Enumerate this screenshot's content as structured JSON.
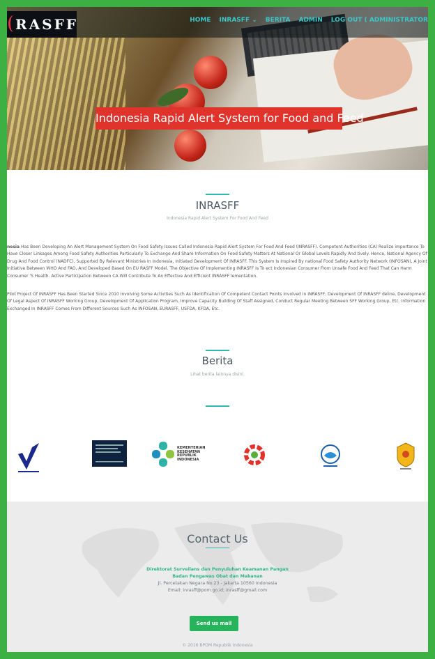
{
  "brand": {
    "logo_text": "RASFF"
  },
  "nav": {
    "items": [
      "HOME",
      "INRASFF",
      "BERITA",
      "ADMIN",
      "LOG OUT ( ADMINISTRATOR"
    ],
    "dropdown_indicator": "⌄"
  },
  "hero": {
    "banner": "Indonesia Rapid Alert System for Food and Feed"
  },
  "about": {
    "title": "INRASFF",
    "subtitle": "Indonesia Rapid Alert System For Food And Feed",
    "paragraph1_lead": "nesia",
    "paragraph1": "Has Been Developing An Alert Management System On Food Safety Issues Called Indonesia Rapid Alert System For Food And Feed (INRASFF). Competent Authorities (CA) Realize importance To Have Closer Linkages Among Food Safety Authorities Particularly To Exchange And Share Information On Food Safety Matters At National Or Global Levels Rapidly And tively. Hence, National Agency Of Drug And Food Control (NADFC), Supported By Relevant Ministries In Indonesia, Initiated Development Of INRASFF. This System Is Inspired By national Food Safety Authority Network (INFOSAN), A Joint Initiative Between WHO And FAO, And Developed Based On EU RASFF Model. The Objective Of Implementing INRASFF Is To ect Indonesian Consumer From Unsafe Food And Feed That Can Harm Consumer 'S Health. Active Participation Between CA Will Contribute To An Effective And Efficient INRASFF lementation.",
    "paragraph2": "Pilot Project Of INRASFF Has Been Started Since 2010 Involving Some Activities Such As Identification Of Competent Contact Points Involved In INRASFF, Development Of INRASFF deline, Development Of Legal Aspect Of INRASFF Working Group, Development Of Application Program, Improve Capacity Building Of Staff Assigned, Conduct Regular Meeting Between SFF Working Group, Etc. Information Exchanged In INRASFF Comes From Different Sources Such As INFOSAN, EURASFF, USFDA, KFDA, Etc."
  },
  "berita": {
    "title": "Berita",
    "subtitle": "Lihat berita lainnya disini."
  },
  "partners": {
    "kemenkes_text": "KEMENTERIAN\nKESEHATAN\nREPUBLIK\nINDONESIA"
  },
  "contact": {
    "title": "Contact Us",
    "org_line1": "Direktorat Surveilans dan Penyuluhan Keamanan Pangan",
    "org_line2": "Badan Pengawas Obat dan Makanan",
    "address": "Jl. Percetakan Negara No.23 - Jakarta 10560 Indonesia",
    "email": "Email: inrasff@pom.go.id; inrasff@gmail.com",
    "button": "Send us mail",
    "copyright": "© 2016 BPOM Republik Indonesia"
  },
  "colors": {
    "frame": "#3cb043",
    "accent": "#33b6b3",
    "banner": "#e0332c",
    "nav": "#3bc6c9",
    "button": "#27b35c"
  }
}
